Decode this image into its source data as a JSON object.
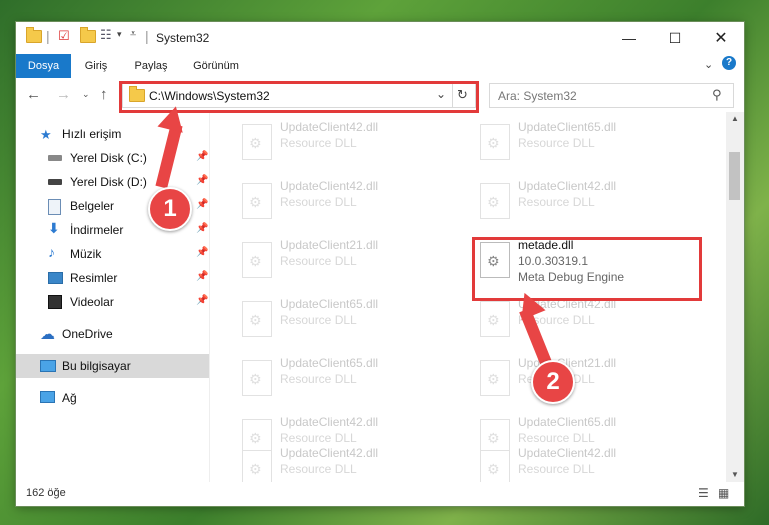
{
  "window": {
    "title": "System32"
  },
  "ribbon": {
    "tabs": [
      "Dosya",
      "Giriş",
      "Paylaş",
      "Görünüm"
    ]
  },
  "address": {
    "path": "C:\\Windows\\System32",
    "search_placeholder": "Ara: System32"
  },
  "sidebar": {
    "quick_access": "Hızlı erişim",
    "items": [
      "Yerel Disk (C:)",
      "Yerel Disk (D:)",
      "Belgeler",
      "İndirmeler",
      "Müzik",
      "Resimler",
      "Videolar"
    ],
    "onedrive": "OneDrive",
    "this_pc": "Bu bilgisayar",
    "network": "Ağ"
  },
  "files": {
    "left": [
      {
        "name": "UpdateClient42.dll",
        "type": "Resource DLL"
      },
      {
        "name": "UpdateClient42.dll",
        "type": "Resource DLL"
      },
      {
        "name": "UpdateClient21.dll",
        "type": "Resource DLL"
      },
      {
        "name": "UpdateClient65.dll",
        "type": "Resource DLL"
      },
      {
        "name": "UpdateClient65.dll",
        "type": "Resource DLL"
      },
      {
        "name": "UpdateClient42.dll",
        "type": "Resource DLL"
      },
      {
        "name": "UpdateClient42.dll",
        "type": "Resource DLL"
      }
    ],
    "right": [
      {
        "name": "UpdateClient65.dll",
        "type": "Resource DLL"
      },
      {
        "name": "UpdateClient42.dll",
        "type": "Resource DLL"
      },
      {
        "name": "metade.dll",
        "version": "10.0.30319.1",
        "type": "Meta Debug Engine"
      },
      {
        "name": "UpdateClient42.dll",
        "type": "Resource DLL"
      },
      {
        "name": "UpdateClient21.dll",
        "type": "Resource DLL"
      },
      {
        "name": "UpdateClient65.dll",
        "type": "Resource DLL"
      },
      {
        "name": "UpdateClient42.dll",
        "type": "Resource DLL"
      }
    ]
  },
  "status": {
    "count": "162 öğe"
  },
  "annotations": {
    "step1": "1",
    "step2": "2"
  },
  "colors": {
    "accent": "#1979ca",
    "annotation": "#e23a3a"
  }
}
